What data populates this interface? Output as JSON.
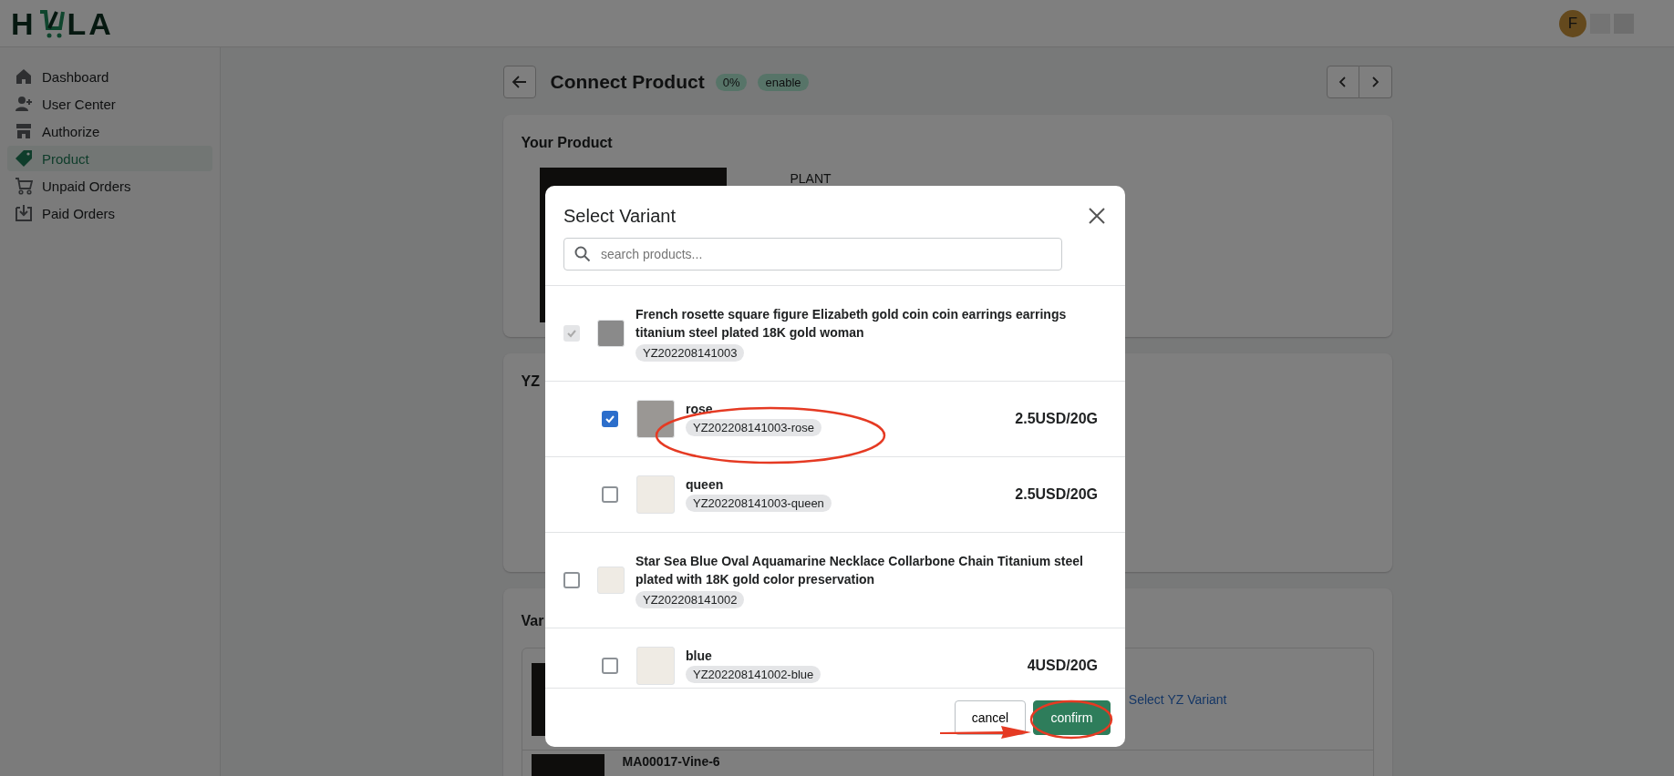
{
  "header": {
    "logo_left": "H",
    "logo_right": "LA",
    "avatar_initial": "F"
  },
  "sidebar": {
    "items": [
      {
        "label": "Dashboard",
        "selected": false
      },
      {
        "label": "User Center",
        "selected": false
      },
      {
        "label": "Authorize",
        "selected": false
      },
      {
        "label": "Product",
        "selected": true
      },
      {
        "label": "Unpaid Orders",
        "selected": false
      },
      {
        "label": "Paid Orders",
        "selected": false
      }
    ]
  },
  "page": {
    "title": "Connect Product",
    "badges": [
      "0%",
      "enable"
    ],
    "your_product": {
      "title": "Your Product",
      "name": "PLANT"
    },
    "yz_card": {
      "title": "YZ"
    },
    "variants_card": {
      "title": "Var",
      "link": "Select YZ Variant",
      "second_row_name": "MA00017-Vine-6"
    }
  },
  "modal": {
    "title": "Select Variant",
    "search": {
      "placeholder": "search products..."
    },
    "items": [
      {
        "kind": "product",
        "title": "French rosette square figure Elizabeth gold coin coin earrings earrings titanium steel plated 18K gold woman",
        "sku": "YZ202208141003",
        "checked": true,
        "disabled": true
      },
      {
        "kind": "variant",
        "title": "rose",
        "sku": "YZ202208141003-rose",
        "price": "2.5USD/20G",
        "checked": true
      },
      {
        "kind": "variant",
        "title": "queen",
        "sku": "YZ202208141003-queen",
        "price": "2.5USD/20G",
        "checked": false
      },
      {
        "kind": "product",
        "title": "Star Sea Blue Oval Aquamarine Necklace Collarbone Chain Titanium steel plated with 18K gold color preservation",
        "sku": "YZ202208141002",
        "checked": false,
        "disabled": false
      },
      {
        "kind": "variant",
        "title": "blue",
        "sku": "YZ202208141002-blue",
        "price": "4USD/20G",
        "checked": false
      }
    ],
    "buttons": {
      "cancel": "cancel",
      "confirm": "confirm"
    }
  }
}
